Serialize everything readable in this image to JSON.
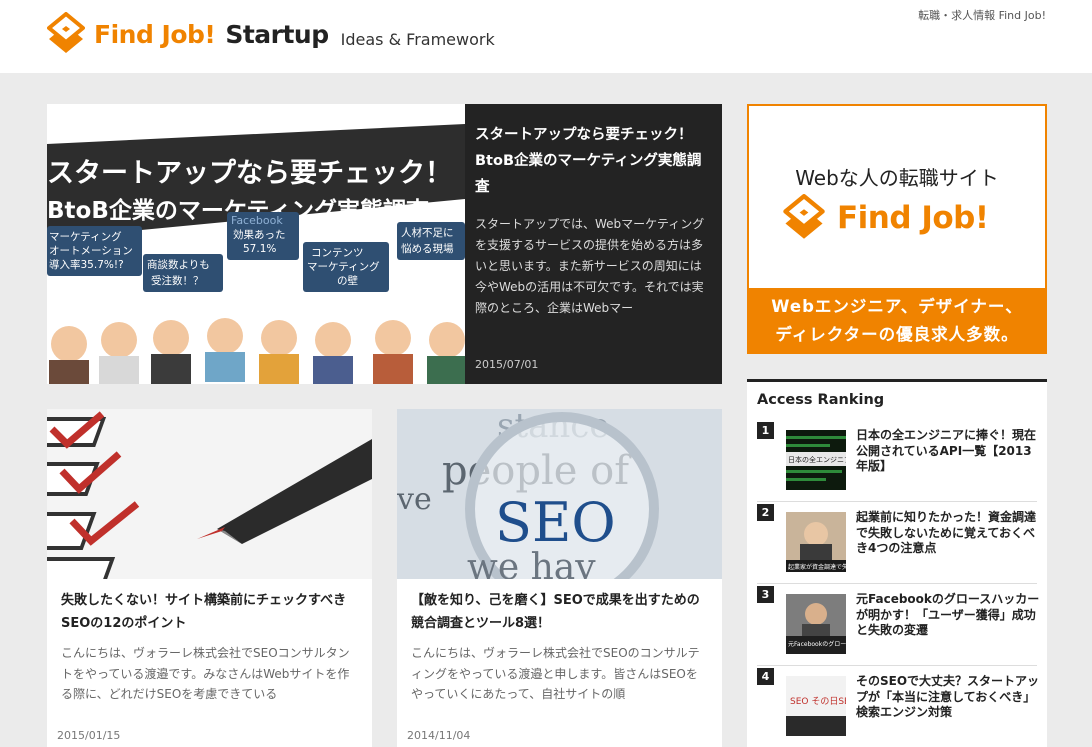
{
  "header": {
    "logo_brand": "Find Job!",
    "logo_site": "Startup",
    "logo_sub": "Ideas & Framework",
    "top_link": "転職・求人情報 Find Job!"
  },
  "featured": {
    "title": "スタートアップなら要チェック！BtoB企業のマーケティング実態調査",
    "excerpt": "スタートアップでは、Webマーケティングを支援するサービスの提供を始める方は多いと思います。また新サービスの周知には今やWebの活用は不可欠です。それでは実際のところ、企業はWebマー",
    "date": "2015/07/01",
    "image": {
      "headline1": "スタートアップなら要チェック！",
      "headline2": "BtoB企業のマーケティング実態調査",
      "bubble_ma_1": "マーケティング",
      "bubble_ma_2": "オートメーション",
      "bubble_ma_3": "導入率35.7%!?",
      "bubble_fb_1": "Facebook",
      "bubble_fb_2": "効果あった",
      "bubble_fb_3": "57.1%",
      "bubble_hr_1": "人材不足に",
      "bubble_hr_2": "悩める現場",
      "bubble_deal_1": "商談数よりも",
      "bubble_deal_2": "受注数！？",
      "bubble_content_1": "コンテンツ",
      "bubble_content_2": "マーケティング",
      "bubble_content_3": "の壁"
    }
  },
  "articles": [
    {
      "title": "失敗したくない！サイト構築前にチェックすべきSEOの12のポイント",
      "excerpt": "こんにちは、ヴォラーレ株式会社でSEOコンサルタントをやっている渡邉です。みなさんはWebサイトを作る際に、どれだけSEOを考慮できている",
      "date": "2015/01/15"
    },
    {
      "title": "【敵を知り、己を磨く】SEOで成果を出すための競合調査とツール8選！",
      "excerpt": "こんにちは、ヴォラーレ株式会社でSEOのコンサルティングをやっている渡邉と申します。皆さんはSEOをやっていくにあたって、自社サイトの順",
      "date": "2014/11/04",
      "image_words": {
        "w1": "stance.",
        "w2": "people of",
        "w3": "SEO",
        "w4": "ve",
        "w5": "we hav"
      }
    }
  ],
  "ad": {
    "tagline": "Webな人の転職サイト",
    "brand": "Find Job!",
    "line1": "Webエンジニア、デザイナー、",
    "line2": "ディレクターの優良求人多数。"
  },
  "ranking": {
    "title": "Access Ranking",
    "items": [
      {
        "rank": "1",
        "text": "日本の全エンジニアに捧ぐ！現在公開されているAPI一覧【2013年版】",
        "thumb_text": "日本の全エンジニアに"
      },
      {
        "rank": "2",
        "text": "起業前に知りたかった！資金調達で失敗しないために覚えておくべき4つの注意点",
        "thumb_text": "起業家が資金調達で失敗しないために"
      },
      {
        "rank": "3",
        "text": "元Facebookのグロースハッカーが明かす！「ユーザー獲得」成功と失敗の変遷",
        "thumb_text": "元Facebookのグロースハッカー ユーザー獲得 成功と失敗"
      },
      {
        "rank": "4",
        "text": "そのSEOで大丈夫？スタートアップが「本当に注意しておくべき」検索エンジン対策",
        "thumb_text": "SEO その日SEOで大丈夫？ スタート 本当に注意しておく"
      }
    ]
  },
  "colors": {
    "accent": "#f08300",
    "dark": "#232323",
    "background": "#ebebeb"
  }
}
